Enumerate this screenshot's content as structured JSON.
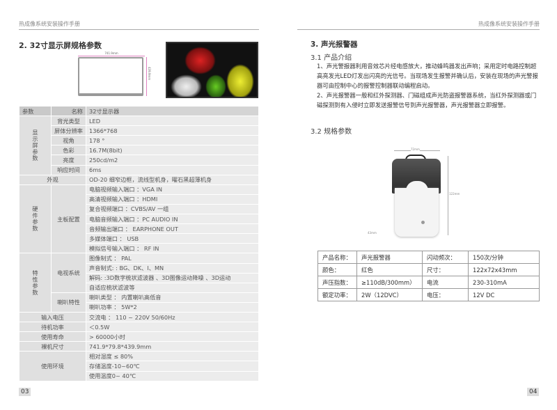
{
  "left": {
    "header": "热成像系统安装操作手册",
    "title": "2.  32寸显示屏规格参数",
    "dim_width": "741.9mm",
    "dim_height": "439.9mm",
    "page_number": "03",
    "table": {
      "h_param": "参数",
      "h_name": "名称",
      "h_value": "32寸显示器",
      "display_group": "显示屏参数",
      "display": [
        [
          "背光类型",
          "LED"
        ],
        [
          "屏体分辨率",
          "1366*768"
        ],
        [
          "视角",
          "178 °"
        ],
        [
          "色彩",
          "16.7M(8bit)"
        ],
        [
          "亮度",
          "250cd/m2"
        ],
        [
          "响应时间",
          "6ms"
        ]
      ],
      "appearance": [
        "外观",
        "OD-20  细窄边框，流线型机身，曜石黑超薄机身"
      ],
      "hw_group": "硬件参数",
      "hw_sub": "主板配置",
      "hw": [
        "电脑视频输入端口 ：VGA IN",
        "高清视频输入端口 ：HDMI",
        "复合视频端口 ：CVBS/AV 一组",
        "电脑音频输入端口 ：PC AUDIO IN",
        "音频输出端口 ：  EARPHONE OUT",
        "多媒体端口 ：  USB",
        "模拟信号输入端口 ：  RF IN"
      ],
      "feat_group": "特性参数",
      "tv_sub": "电视系统",
      "tv": [
        "图像制式 ：  PAL",
        "声音制式: : BG、DK、I、MN",
        "解码: :3D数字梳状滤波器 、3D图像运动降噪 、3D运动",
        "自适应梳状滤波等"
      ],
      "spk_sub": "喇叭特性",
      "spk": [
        "喇叭类型 ：  内置喇叭高低音",
        "喇叭功率 ：  5W*2"
      ],
      "misc": [
        [
          "输入电压",
          "交流电 ：  110 ~ 220V   50/60Hz"
        ],
        [
          "待机功率",
          "＜0.5W"
        ],
        [
          "使用寿命",
          "> 60000小时"
        ],
        [
          "裸机尺寸",
          "741.9*79.8*439.9mm"
        ]
      ],
      "env_label": "使用环境",
      "env": [
        "相对湿度 ≤ 80%",
        "存储温度-10~60℃",
        "使用温度0~ 40℃"
      ]
    }
  },
  "right": {
    "header": "热成像系统安装操作手册",
    "title": "3.  声光报警器",
    "s1": "3.1  产品介绍",
    "p1": "1、声光警报器利用音效芯片经电感放大，推动蜂鸣器发出声响；采用定时电路控制超高亮发光LED灯发出闪亮的光信号。当现场发生报警并确认后，安装在现场的声光警报器可由控制中心的报警控制器联动编程启动。",
    "p2": "2、声光报警器一般和红外探测器、门磁组成声光防盗报警器系统，当红外探测器或门磁探测到有入侵时立即发送报警信号到声光报警器，声光报警器立即报警。",
    "s2": "3.2  规格参数",
    "dim_w": "72mm",
    "dim_h": "122mm",
    "dim_d": "43mm",
    "page_number": "04",
    "table": [
      [
        "产品名称：",
        "声光报警器",
        "闪动频次：",
        "150次/分钟"
      ],
      [
        "颜色：",
        "红色",
        "尺寸：",
        "122x72x43mm"
      ],
      [
        "声压指数：",
        "≥110dB/300mm）",
        "电流",
        "230-310mA"
      ],
      [
        "额定功率：",
        "2W（12DVC）",
        "电压：",
        "12V DC"
      ]
    ]
  }
}
